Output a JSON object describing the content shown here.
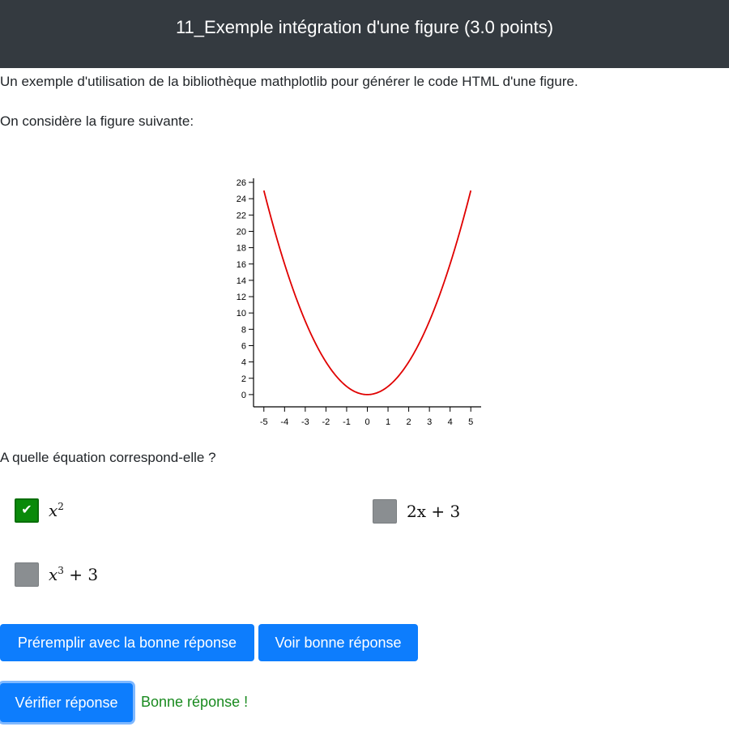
{
  "header": {
    "title": "11_Exemple intégration d'une figure (3.0 points)"
  },
  "content": {
    "intro": "Un exemple d'utilisation de la bibliothèque mathplotlib pour générer le code HTML d'une figure.",
    "prompt": "On considère la figure suivante:",
    "question": "A quelle équation correspond-elle ?"
  },
  "chart_data": {
    "type": "line",
    "title": "",
    "xlabel": "",
    "ylabel": "",
    "xlim": [
      -5.5,
      5.5
    ],
    "ylim": [
      -1.5,
      26.5
    ],
    "x_ticks": [
      -5,
      -4,
      -3,
      -2,
      -1,
      0,
      1,
      2,
      3,
      4,
      5
    ],
    "y_ticks": [
      0,
      2,
      4,
      6,
      8,
      10,
      12,
      14,
      16,
      18,
      20,
      22,
      24,
      26
    ],
    "grid": false,
    "series": [
      {
        "color": "#e00000",
        "x": [
          -5,
          -4.5,
          -4,
          -3.5,
          -3,
          -2.5,
          -2,
          -1.5,
          -1,
          -0.5,
          0,
          0.5,
          1,
          1.5,
          2,
          2.5,
          3,
          3.5,
          4,
          4.5,
          5
        ],
        "y": [
          25,
          20.25,
          16,
          12.25,
          9,
          6.25,
          4,
          2.25,
          1,
          0.25,
          0,
          0.25,
          1,
          2.25,
          4,
          6.25,
          9,
          12.25,
          16,
          20.25,
          25
        ]
      }
    ]
  },
  "options": [
    {
      "base": "x",
      "sup": "2",
      "tail": "",
      "checked": true,
      "check_icon": "check-icon"
    },
    {
      "base": "",
      "sup": "",
      "tail": "2x + 3",
      "checked": false
    },
    {
      "base": "x",
      "sup": "3",
      "tail": " + 3",
      "checked": false
    }
  ],
  "buttons": {
    "prefill": "Préremplir avec la bonne réponse",
    "show": "Voir bonne réponse",
    "verify": "Vérifier réponse"
  },
  "feedback": {
    "text": "Bonne réponse !",
    "color": "#198a1f"
  },
  "colors": {
    "header_bg": "#343a40",
    "button_bg": "#0d7dfd",
    "checked_bg": "#0a8a0a",
    "unchecked_bg": "#8a8e91"
  }
}
